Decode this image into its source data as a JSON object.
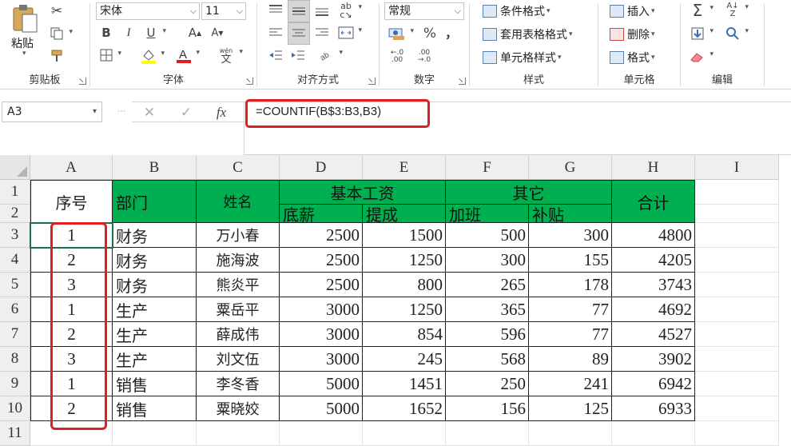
{
  "ribbon": {
    "clipboard": {
      "paste": "粘贴",
      "label": "剪贴板"
    },
    "font": {
      "name": "宋体",
      "size": "11",
      "bold": "B",
      "italic": "I",
      "underline": "U",
      "grow": "A",
      "shrink": "A",
      "label": "字体",
      "font_color": "#e02020",
      "fill_color": "#ffff00",
      "wen": "wén",
      "wen_char": "文"
    },
    "alignment": {
      "label": "对齐方式"
    },
    "number": {
      "format": "常规",
      "percent": "%",
      "comma": "，",
      "label": "数字"
    },
    "styles": {
      "conditional": "条件格式",
      "table": "套用表格格式",
      "cell": "单元格样式",
      "label": "样式"
    },
    "cells": {
      "insert": "插入",
      "delete": "删除",
      "format": "格式",
      "label": "单元格"
    },
    "editing": {
      "label": "编辑"
    }
  },
  "formula_bar": {
    "name_box": "A3",
    "cancel": "✕",
    "enter": "✓",
    "fx": "fx",
    "formula": "=COUNTIF(B$3:B3,B3)"
  },
  "sheet": {
    "columns": [
      "A",
      "B",
      "C",
      "D",
      "E",
      "F",
      "G",
      "H",
      "I"
    ],
    "rows": [
      "1",
      "2",
      "3",
      "4",
      "5",
      "6",
      "7",
      "8",
      "9",
      "10",
      "11"
    ],
    "headers": {
      "seq": "序号",
      "dept": "部门",
      "name": "姓名",
      "base_group": "基本工资",
      "base": "底薪",
      "commission": "提成",
      "other_group": "其它",
      "overtime": "加班",
      "allowance": "补贴",
      "total": "合计"
    },
    "records": [
      {
        "seq": "1",
        "dept": "财务",
        "name": "万小春",
        "base": "2500",
        "commission": "1500",
        "overtime": "500",
        "allowance": "300",
        "total": "4800"
      },
      {
        "seq": "2",
        "dept": "财务",
        "name": "施海波",
        "base": "2500",
        "commission": "1250",
        "overtime": "300",
        "allowance": "155",
        "total": "4205"
      },
      {
        "seq": "3",
        "dept": "财务",
        "name": "熊炎平",
        "base": "2500",
        "commission": "800",
        "overtime": "265",
        "allowance": "178",
        "total": "3743"
      },
      {
        "seq": "1",
        "dept": "生产",
        "name": "粟岳平",
        "base": "3000",
        "commission": "1250",
        "overtime": "365",
        "allowance": "77",
        "total": "4692"
      },
      {
        "seq": "2",
        "dept": "生产",
        "name": "薛成伟",
        "base": "3000",
        "commission": "854",
        "overtime": "596",
        "allowance": "77",
        "total": "4527"
      },
      {
        "seq": "3",
        "dept": "生产",
        "name": "刘文伍",
        "base": "3000",
        "commission": "245",
        "overtime": "568",
        "allowance": "89",
        "total": "3902"
      },
      {
        "seq": "1",
        "dept": "销售",
        "name": "李冬香",
        "base": "5000",
        "commission": "1451",
        "overtime": "250",
        "allowance": "241",
        "total": "6942"
      },
      {
        "seq": "2",
        "dept": "销售",
        "name": "粟晓姣",
        "base": "5000",
        "commission": "1652",
        "overtime": "156",
        "allowance": "125",
        "total": "6933"
      }
    ]
  },
  "colors": {
    "header_green": "#00b050",
    "highlight_red": "#e02020",
    "selection_green": "#1e7145"
  }
}
